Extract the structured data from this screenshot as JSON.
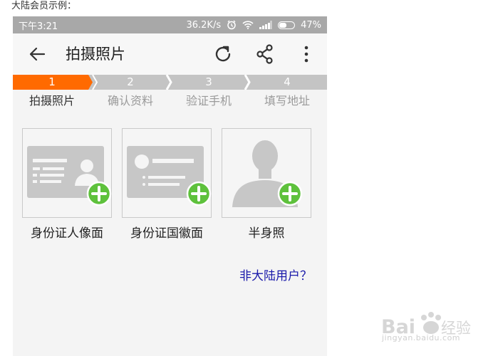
{
  "caption": "大陆会员示例：",
  "status_bar": {
    "time": "下午3:21",
    "speed": "36.2K/s",
    "battery": "47%"
  },
  "app_bar": {
    "title": "拍摄照片"
  },
  "steps": [
    {
      "number": "1",
      "label": "拍摄照片",
      "active": true
    },
    {
      "number": "2",
      "label": "确认资料",
      "active": false
    },
    {
      "number": "3",
      "label": "验证手机",
      "active": false
    },
    {
      "number": "4",
      "label": "填写地址",
      "active": false
    }
  ],
  "cards": [
    {
      "label": "身份证人像面",
      "icon": "id-card-front-icon"
    },
    {
      "label": "身份证国徽面",
      "icon": "id-card-back-icon"
    },
    {
      "label": "半身照",
      "icon": "half-body-photo-icon"
    }
  ],
  "non_mainland_link": "非大陆用户？",
  "watermark": {
    "logo": "Baidu经验",
    "url": "jingyan.baidu.com"
  },
  "colors": {
    "accent_orange": "#ff6a00",
    "step_inactive": "#c4c4c4",
    "add_green": "#5ec13c",
    "link_blue": "#1a1aaa"
  }
}
